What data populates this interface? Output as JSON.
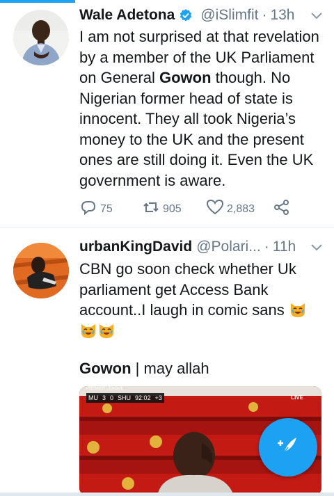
{
  "tweets": [
    {
      "name": "Wale Adetona",
      "handle": "@iSlimfit",
      "separator": "·",
      "time": "13h",
      "text_before": "I am not surprised at that revelation by a member of the UK Parliament on General ",
      "text_bold": "Gowon",
      "text_after": " though. No Nigerian former head of state is innocent. They all took Nigeria’s money to the UK and the present ones are still doing it. Even the UK government is aware.",
      "replies": "75",
      "retweets": "905",
      "likes": "2,883"
    },
    {
      "name": "urbanKingDavid",
      "handle": "@Polari...",
      "separator": "·",
      "time": "11h",
      "text": "CBN go soon check whether Uk parliament get Access Bank account..I laugh in comic sans",
      "caption_bold": "Gowon",
      "caption_rest": " | may allah",
      "media_overlay": {
        "league": "PREMIER LEAGUE",
        "home": "MU",
        "home_score": "3",
        "away_score": "0",
        "away": "SHU",
        "clock": "92:02",
        "added": "+3",
        "live": "LIVE"
      }
    }
  ],
  "icons": {
    "verified": "verified-badge-icon",
    "chevron": "chevron-down-icon",
    "reply": "reply-icon",
    "retweet": "retweet-icon",
    "like": "heart-icon",
    "share": "share-icon",
    "emoji": "laughing-cat-emoji",
    "compose": "compose-tweet-icon"
  },
  "colors": {
    "accent": "#1da1f2",
    "text": "#14171a",
    "secondary": "#657786"
  }
}
